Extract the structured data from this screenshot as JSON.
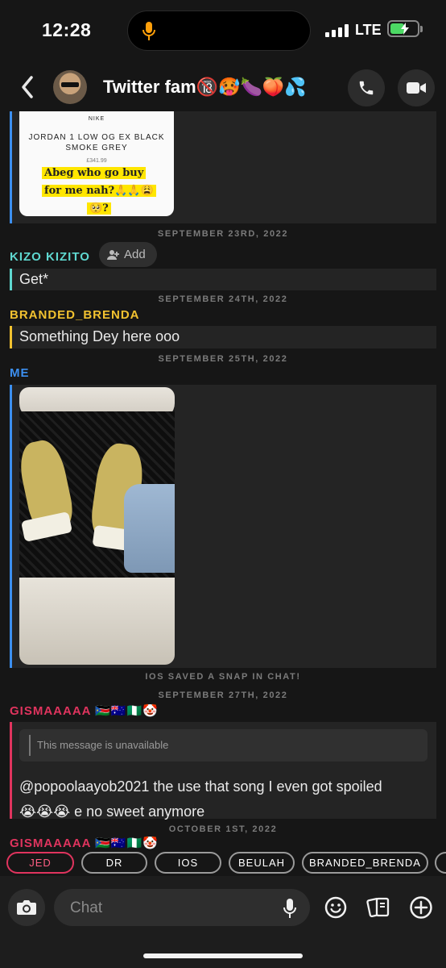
{
  "status_bar": {
    "time": "12:28",
    "network": "LTE"
  },
  "header": {
    "title": "Twitter fam🔞🥵🍆🍑💦"
  },
  "messages": {
    "snap1": {
      "brand": "NIKE",
      "product_line1": "JORDAN 1 LOW OG EX BLACK",
      "product_line2": "SMOKE GREY",
      "price": "£341.99",
      "caption_line1": "Abeg who go buy",
      "caption_line2": "for me nah?🙏🙏😩",
      "caption_line3": "🥺?"
    },
    "date1": "SEPTEMBER 23RD, 2022",
    "sender1": "KIZO KIZITO",
    "add_label": "Add",
    "msg1": "Get*",
    "date2": "SEPTEMBER 24TH, 2022",
    "sender2": "BRANDED_BRENDA",
    "msg2": "Something Dey here ooo",
    "date3": "SEPTEMBER 25TH, 2022",
    "sender3": "ME",
    "saved_note": "IOS SAVED A SNAP IN CHAT!",
    "date4": "SEPTEMBER 27TH, 2022",
    "sender4": "GISMAAAAA 🇸🇸🇦🇺🇳🇬🤡",
    "quoted_text": "This message is unavailable",
    "msg4_line1": "@popoolaayob2021 the use that song I even got spoiled",
    "msg4_line2": "😭😭😭 e no sweet anymore",
    "date5": "OCTOBER 1ST, 2022",
    "sender5": "GISMAAAAA 🇸🇸🇦🇺🇳🇬🤡"
  },
  "mentions": [
    "JED",
    "DR",
    "IOS",
    "BEULAH",
    "BRANDED_BRENDA"
  ],
  "input": {
    "placeholder": "Chat"
  },
  "colors": {
    "kizo": "#5fd8d0",
    "brenda": "#f2c230",
    "me": "#3c8ff0",
    "gisma": "#e0345e",
    "active_chip": "#e0345e"
  }
}
